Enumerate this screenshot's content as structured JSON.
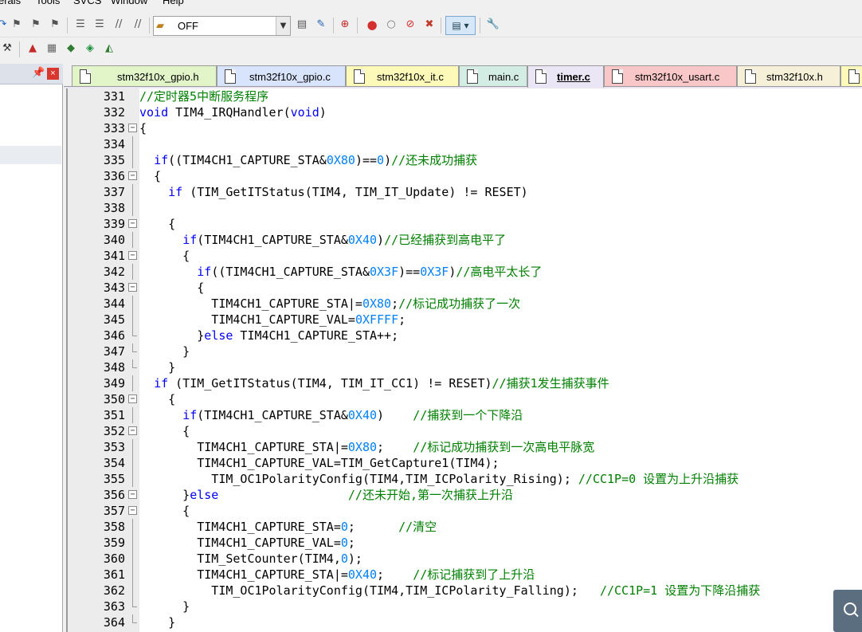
{
  "menu": [
    "erals",
    "Tools",
    "SVCS",
    "Window",
    "Help"
  ],
  "toolbar": {
    "target_value": "OFF"
  },
  "tabs": [
    {
      "label": "stm32f10x_gpio.h",
      "color": "#e2f5c8"
    },
    {
      "label": "stm32f10x_gpio.c",
      "color": "#d8e4fc"
    },
    {
      "label": "stm32f10x_it.c",
      "color": "#fdf9b8"
    },
    {
      "label": "main.c",
      "color": "#d3ede4"
    },
    {
      "label": "timer.c",
      "color": "#ebe6f5"
    },
    {
      "label": "stm32f10x_usart.c",
      "color": "#f9c7c7"
    },
    {
      "label": "stm32f10x.h",
      "color": "#f6f0d8"
    },
    {
      "label": "",
      "color": "#fdf9b8"
    }
  ],
  "active_tab": "timer.c",
  "editor": {
    "lines": [
      {
        "n": "331",
        "fold": "",
        "t": [
          [
            "c",
            "//定时器5中断服务程序"
          ]
        ]
      },
      {
        "n": "332",
        "fold": "",
        "t": [
          [
            "k",
            "void"
          ],
          [
            "p",
            " TIM4_IRQHandler("
          ],
          [
            "k",
            "void"
          ],
          [
            "p",
            ")"
          ]
        ]
      },
      {
        "n": "333",
        "fold": "minus",
        "t": [
          [
            "p",
            "{"
          ]
        ]
      },
      {
        "n": "334",
        "fold": "line",
        "t": []
      },
      {
        "n": "335",
        "fold": "line",
        "t": [
          [
            "p",
            "  "
          ],
          [
            "k",
            "if"
          ],
          [
            "p",
            "((TIM4CH1_CAPTURE_STA&"
          ],
          [
            "n",
            "0X80"
          ],
          [
            "p",
            ")=="
          ],
          [
            "n",
            "0"
          ],
          [
            "p",
            ")"
          ],
          [
            "c",
            "//还未成功捕获"
          ]
        ]
      },
      {
        "n": "336",
        "fold": "minus",
        "t": [
          [
            "p",
            "  {"
          ]
        ]
      },
      {
        "n": "337",
        "fold": "line",
        "t": [
          [
            "p",
            "    "
          ],
          [
            "k",
            "if"
          ],
          [
            "p",
            " (TIM_GetITStatus(TIM4, TIM_IT_Update) != RESET)"
          ]
        ]
      },
      {
        "n": "338",
        "fold": "line",
        "t": []
      },
      {
        "n": "339",
        "fold": "minus",
        "t": [
          [
            "p",
            "    {"
          ]
        ]
      },
      {
        "n": "340",
        "fold": "line",
        "t": [
          [
            "p",
            "      "
          ],
          [
            "k",
            "if"
          ],
          [
            "p",
            "(TIM4CH1_CAPTURE_STA&"
          ],
          [
            "n",
            "0X40"
          ],
          [
            "p",
            ")"
          ],
          [
            "c",
            "//已经捕获到高电平了"
          ]
        ]
      },
      {
        "n": "341",
        "fold": "minus",
        "t": [
          [
            "p",
            "      {"
          ]
        ]
      },
      {
        "n": "342",
        "fold": "line",
        "t": [
          [
            "p",
            "        "
          ],
          [
            "k",
            "if"
          ],
          [
            "p",
            "((TIM4CH1_CAPTURE_STA&"
          ],
          [
            "n",
            "0X3F"
          ],
          [
            "p",
            ")=="
          ],
          [
            "n",
            "0X3F"
          ],
          [
            "p",
            ")"
          ],
          [
            "c",
            "//高电平太长了"
          ]
        ]
      },
      {
        "n": "343",
        "fold": "minus",
        "t": [
          [
            "p",
            "        {"
          ]
        ]
      },
      {
        "n": "344",
        "fold": "line",
        "t": [
          [
            "p",
            "          TIM4CH1_CAPTURE_STA|="
          ],
          [
            "n",
            "0X80"
          ],
          [
            "p",
            ";"
          ],
          [
            "c",
            "//标记成功捕获了一次"
          ]
        ]
      },
      {
        "n": "345",
        "fold": "line",
        "t": [
          [
            "p",
            "          TIM4CH1_CAPTURE_VAL="
          ],
          [
            "n",
            "0XFFFF"
          ],
          [
            "p",
            ";"
          ]
        ]
      },
      {
        "n": "346",
        "fold": "end",
        "t": [
          [
            "p",
            "        }"
          ],
          [
            "k",
            "else"
          ],
          [
            "p",
            " TIM4CH1_CAPTURE_STA++;"
          ]
        ]
      },
      {
        "n": "347",
        "fold": "end",
        "t": [
          [
            "p",
            "      }"
          ]
        ]
      },
      {
        "n": "348",
        "fold": "end",
        "t": [
          [
            "p",
            "    }"
          ]
        ]
      },
      {
        "n": "349",
        "fold": "line",
        "t": [
          [
            "p",
            "  "
          ],
          [
            "k",
            "if"
          ],
          [
            "p",
            " (TIM_GetITStatus(TIM4, TIM_IT_CC1) != RESET)"
          ],
          [
            "c",
            "//捕获1发生捕获事件"
          ]
        ]
      },
      {
        "n": "350",
        "fold": "minus",
        "t": [
          [
            "p",
            "    {"
          ]
        ]
      },
      {
        "n": "351",
        "fold": "line",
        "t": [
          [
            "p",
            "      "
          ],
          [
            "k",
            "if"
          ],
          [
            "p",
            "(TIM4CH1_CAPTURE_STA&"
          ],
          [
            "n",
            "0X40"
          ],
          [
            "p",
            ")    "
          ],
          [
            "c",
            "//捕获到一个下降沿"
          ]
        ]
      },
      {
        "n": "352",
        "fold": "minus",
        "t": [
          [
            "p",
            "      {"
          ]
        ]
      },
      {
        "n": "353",
        "fold": "line",
        "t": [
          [
            "p",
            "        TIM4CH1_CAPTURE_STA|="
          ],
          [
            "n",
            "0X80"
          ],
          [
            "p",
            ";    "
          ],
          [
            "c",
            "//标记成功捕获到一次高电平脉宽"
          ]
        ]
      },
      {
        "n": "354",
        "fold": "line",
        "t": [
          [
            "p",
            "        TIM4CH1_CAPTURE_VAL=TIM_GetCapture1(TIM4);"
          ]
        ]
      },
      {
        "n": "355",
        "fold": "line",
        "t": [
          [
            "p",
            "          TIM_OC1PolarityConfig(TIM4,TIM_ICPolarity_Rising); "
          ],
          [
            "c",
            "//CC1P=0 设置为上升沿捕获"
          ]
        ]
      },
      {
        "n": "356",
        "fold": "minus",
        "t": [
          [
            "p",
            "      }"
          ],
          [
            "k",
            "else"
          ],
          [
            "p",
            "                  "
          ],
          [
            "c",
            "//还未开始,第一次捕获上升沿"
          ]
        ]
      },
      {
        "n": "357",
        "fold": "minus",
        "t": [
          [
            "p",
            "      {"
          ]
        ]
      },
      {
        "n": "358",
        "fold": "line",
        "t": [
          [
            "p",
            "        TIM4CH1_CAPTURE_STA="
          ],
          [
            "n",
            "0"
          ],
          [
            "p",
            ";      "
          ],
          [
            "c",
            "//清空"
          ]
        ]
      },
      {
        "n": "359",
        "fold": "line",
        "t": [
          [
            "p",
            "        TIM4CH1_CAPTURE_VAL="
          ],
          [
            "n",
            "0"
          ],
          [
            "p",
            ";"
          ]
        ]
      },
      {
        "n": "360",
        "fold": "line",
        "t": [
          [
            "p",
            "        TIM_SetCounter(TIM4,"
          ],
          [
            "n",
            "0"
          ],
          [
            "p",
            ");"
          ]
        ]
      },
      {
        "n": "361",
        "fold": "line",
        "t": [
          [
            "p",
            "        TIM4CH1_CAPTURE_STA|="
          ],
          [
            "n",
            "0X40"
          ],
          [
            "p",
            ";    "
          ],
          [
            "c",
            "//标记捕获到了上升沿"
          ]
        ]
      },
      {
        "n": "362",
        "fold": "line",
        "t": [
          [
            "p",
            "          TIM_OC1PolarityConfig(TIM4,TIM_ICPolarity_Falling);   "
          ],
          [
            "c",
            "//CC1P=1 设置为下降沿捕获"
          ]
        ]
      },
      {
        "n": "363",
        "fold": "end",
        "t": [
          [
            "p",
            "      }"
          ]
        ]
      },
      {
        "n": "364",
        "fold": "end",
        "t": [
          [
            "p",
            "    }"
          ]
        ]
      }
    ]
  }
}
